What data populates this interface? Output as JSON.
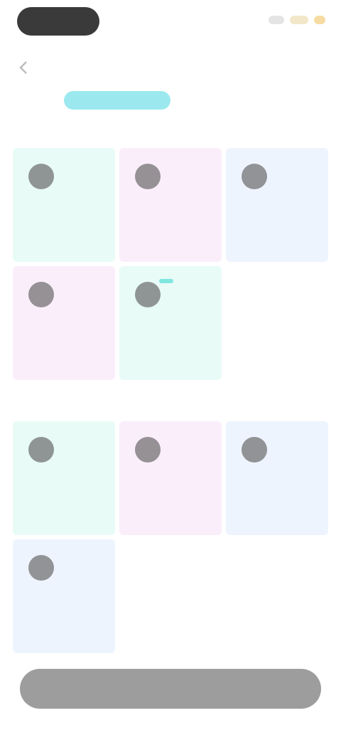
{
  "status_bar": {
    "icons": [
      "signal-icon",
      "wifi-icon",
      "battery-icon"
    ]
  },
  "header": {
    "title": "",
    "back_icon": "back-arrow-icon"
  },
  "tabs": [
    {
      "label": ""
    },
    {
      "label": ""
    }
  ],
  "sections": [
    {
      "title": "",
      "cards": [
        {
          "label": "",
          "color": "mint"
        },
        {
          "label": "",
          "color": "pink"
        },
        {
          "label": "",
          "color": "blue"
        },
        {
          "label": "",
          "color": "pink"
        },
        {
          "label": "",
          "color": "mint",
          "badge": ""
        }
      ]
    },
    {
      "title": "",
      "cards": [
        {
          "label": "",
          "color": "mint"
        },
        {
          "label": "",
          "color": "pink"
        },
        {
          "label": "",
          "color": "blue"
        },
        {
          "label": "",
          "color": "blue"
        }
      ]
    }
  ],
  "bottom_action": {
    "label": ""
  },
  "colors": {
    "accent": "#9be9ee",
    "mint": "#e8fbf7",
    "pink": "#fbeefb",
    "blue": "#eef4fe",
    "button": "#9d9d9d"
  }
}
